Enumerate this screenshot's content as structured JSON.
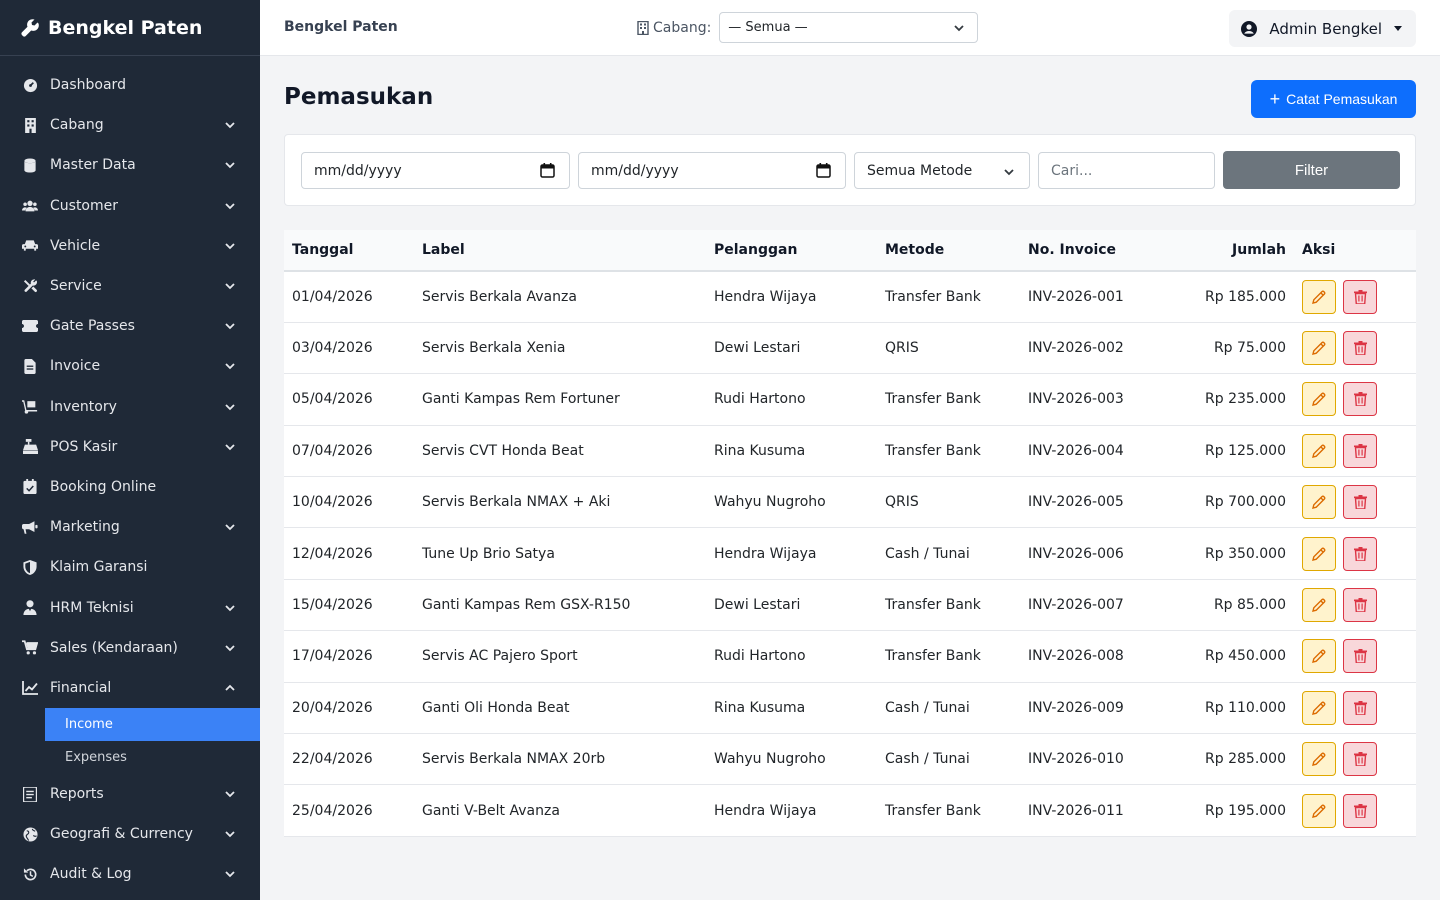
{
  "brand": {
    "name": "Bengkel Paten"
  },
  "sidebar": {
    "items": [
      {
        "label": "Dashboard",
        "icon": "gauge-icon",
        "expandable": false
      },
      {
        "label": "Cabang",
        "icon": "building-icon",
        "expandable": true
      },
      {
        "label": "Master Data",
        "icon": "database-icon",
        "expandable": true
      },
      {
        "label": "Customer",
        "icon": "users-icon",
        "expandable": true
      },
      {
        "label": "Vehicle",
        "icon": "car-icon",
        "expandable": true
      },
      {
        "label": "Service",
        "icon": "tools-icon",
        "expandable": true
      },
      {
        "label": "Gate Passes",
        "icon": "ticket-icon",
        "expandable": true
      },
      {
        "label": "Invoice",
        "icon": "file-invoice-icon",
        "expandable": true
      },
      {
        "label": "Inventory",
        "icon": "dolly-icon",
        "expandable": true
      },
      {
        "label": "POS Kasir",
        "icon": "cash-register-icon",
        "expandable": true
      },
      {
        "label": "Booking Online",
        "icon": "calendar-check-icon",
        "expandable": false
      },
      {
        "label": "Marketing",
        "icon": "bullhorn-icon",
        "expandable": true
      },
      {
        "label": "Klaim Garansi",
        "icon": "shield-icon",
        "expandable": false
      },
      {
        "label": "HRM Teknisi",
        "icon": "user-tie-icon",
        "expandable": true
      },
      {
        "label": "Sales (Kendaraan)",
        "icon": "cart-icon",
        "expandable": true
      },
      {
        "label": "Financial",
        "icon": "chart-line-icon",
        "expandable": true,
        "expanded": true
      }
    ],
    "financial_sub": [
      {
        "label": "Income",
        "active": true
      },
      {
        "label": "Expenses",
        "active": false
      }
    ],
    "items_after": [
      {
        "label": "Reports",
        "icon": "list-icon",
        "expandable": true
      },
      {
        "label": "Geografi & Currency",
        "icon": "globe-icon",
        "expandable": true
      },
      {
        "label": "Audit & Log",
        "icon": "history-icon",
        "expandable": true
      }
    ]
  },
  "topbar": {
    "title": "Bengkel Paten",
    "cabang_label": "Cabang:",
    "cabang_value": "— Semua —",
    "user": "Admin Bengkel"
  },
  "page": {
    "title": "Pemasukan",
    "add_button": "Catat Pemasukan"
  },
  "filters": {
    "date_from_placeholder": "mm/dd/yyyy",
    "date_to_placeholder": "mm/dd/yyyy",
    "metode": "Semua Metode",
    "search_placeholder": "Cari...",
    "filter_button": "Filter"
  },
  "table": {
    "columns": [
      "Tanggal",
      "Label",
      "Pelanggan",
      "Metode",
      "No. Invoice",
      "Jumlah",
      "Aksi"
    ],
    "rows": [
      [
        "01/04/2026",
        "Servis Berkala Avanza",
        "Hendra Wijaya",
        "Transfer Bank",
        "INV-2026-001",
        "Rp 185.000"
      ],
      [
        "03/04/2026",
        "Servis Berkala Xenia",
        "Dewi Lestari",
        "QRIS",
        "INV-2026-002",
        "Rp 75.000"
      ],
      [
        "05/04/2026",
        "Ganti Kampas Rem Fortuner",
        "Rudi Hartono",
        "Transfer Bank",
        "INV-2026-003",
        "Rp 235.000"
      ],
      [
        "07/04/2026",
        "Servis CVT Honda Beat",
        "Rina Kusuma",
        "Transfer Bank",
        "INV-2026-004",
        "Rp 125.000"
      ],
      [
        "10/04/2026",
        "Servis Berkala NMAX + Aki",
        "Wahyu Nugroho",
        "QRIS",
        "INV-2026-005",
        "Rp 700.000"
      ],
      [
        "12/04/2026",
        "Tune Up Brio Satya",
        "Hendra Wijaya",
        "Cash / Tunai",
        "INV-2026-006",
        "Rp 350.000"
      ],
      [
        "15/04/2026",
        "Ganti Kampas Rem GSX-R150",
        "Dewi Lestari",
        "Transfer Bank",
        "INV-2026-007",
        "Rp 85.000"
      ],
      [
        "17/04/2026",
        "Servis AC Pajero Sport",
        "Rudi Hartono",
        "Transfer Bank",
        "INV-2026-008",
        "Rp 450.000"
      ],
      [
        "20/04/2026",
        "Ganti Oli Honda Beat",
        "Rina Kusuma",
        "Cash / Tunai",
        "INV-2026-009",
        "Rp 110.000"
      ],
      [
        "22/04/2026",
        "Servis Berkala NMAX 20rb",
        "Wahyu Nugroho",
        "Cash / Tunai",
        "INV-2026-010",
        "Rp 285.000"
      ],
      [
        "25/04/2026",
        "Ganti V-Belt Avanza",
        "Hendra Wijaya",
        "Transfer Bank",
        "INV-2026-011",
        "Rp 195.000"
      ]
    ]
  },
  "colors": {
    "sidebar_bg": "#1f2937",
    "active_item": "#3b82f6",
    "primary": "#0d6efd",
    "secondary": "#6c757d",
    "warning": "#ffc107",
    "danger": "#dc3545"
  }
}
